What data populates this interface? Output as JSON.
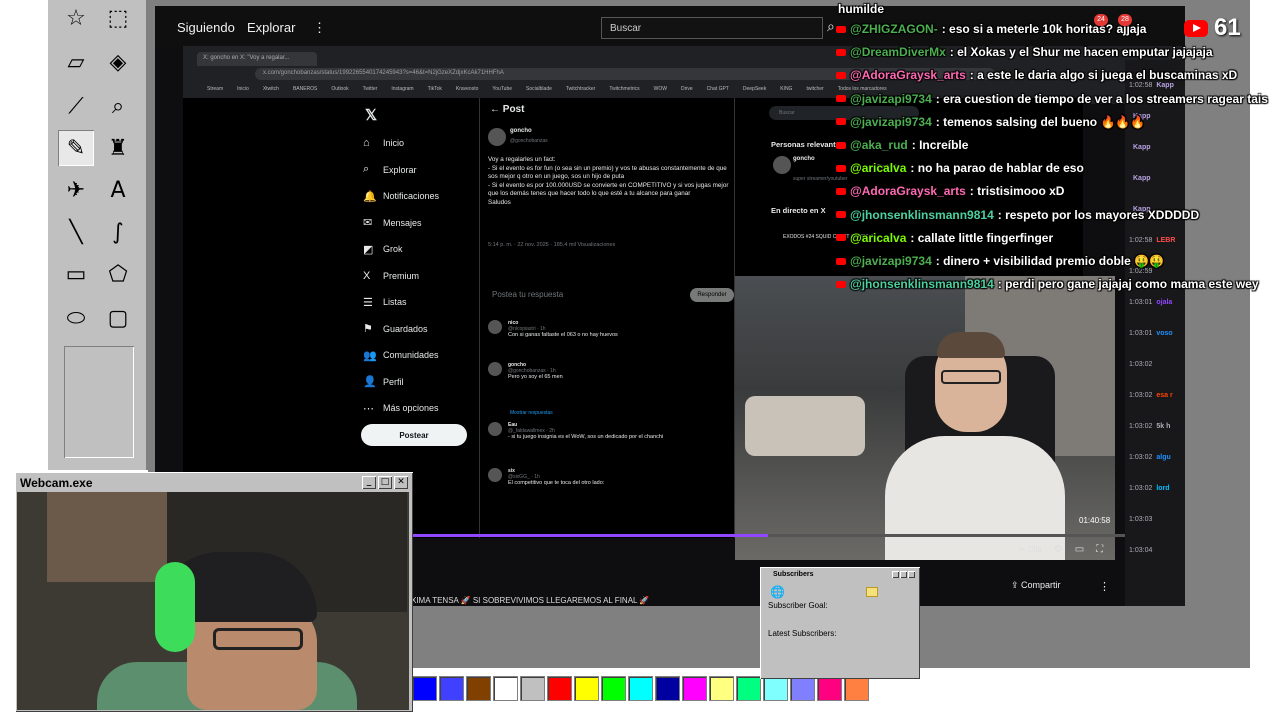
{
  "paint": {
    "tools": [
      "free-select",
      "rect-select",
      "eraser",
      "fill",
      "eyedropper",
      "zoom",
      "pencil",
      "brush",
      "airbrush",
      "text",
      "line",
      "curve",
      "rectangle",
      "polygon",
      "ellipse",
      "rounded-rect"
    ],
    "palette": [
      "#0000ff",
      "#4040ff",
      "#804000",
      "#ffffff",
      "#c0c0c0",
      "#ff0000",
      "#ffff00",
      "#00ff00",
      "#00ffff",
      "#0000a0",
      "#ff00ff",
      "#ffff80",
      "#00ff80",
      "#80ffff",
      "#8080ff",
      "#ff0080",
      "#ff8040"
    ]
  },
  "youtube": {
    "nav": [
      "Siguiendo",
      "Explorar"
    ],
    "more": "⋮",
    "search_placeholder": "Buscar",
    "share": "Compartir",
    "clip": "Clip",
    "time": "01:40:58",
    "progress": 0.48,
    "stream_title": "XIMA TENSA 🚀 SI SOBREVIVIMOS LLEGAREMOS AL FINAL 🚀"
  },
  "browser": {
    "tab": "X: goncho en X: \"Voy a regalar...",
    "url": "x.com/gonchobanzas/status/1992265540174245943?s=46&t=N2jGzeXZdjxKcAk71HHFhA",
    "bookmarks": [
      "Stream",
      "Inicio",
      "Xtwitch",
      "BANEROS",
      "Outlook",
      "Twitter",
      "Instagram",
      "TikTok",
      "Kraveosto",
      "YouTube",
      "Socialblade",
      "Twitchtracker",
      "Twitchmetrics",
      "WOW",
      "Drive",
      "Chat GPT",
      "DeepSeek",
      "KING",
      "twitcher",
      "Todos los marcadores"
    ]
  },
  "x": {
    "nav": [
      {
        "icon": "⌂",
        "label": "Inicio"
      },
      {
        "icon": "⌕",
        "label": "Explorar"
      },
      {
        "icon": "🔔",
        "label": "Notificaciones"
      },
      {
        "icon": "✉",
        "label": "Mensajes"
      },
      {
        "icon": "◩",
        "label": "Grok"
      },
      {
        "icon": "X",
        "label": "Premium"
      },
      {
        "icon": "☰",
        "label": "Listas"
      },
      {
        "icon": "⚑",
        "label": "Guardados"
      },
      {
        "icon": "👥",
        "label": "Comunidades"
      },
      {
        "icon": "👤",
        "label": "Perfil"
      },
      {
        "icon": "⋯",
        "label": "Más opciones"
      }
    ],
    "post_button": "Postear",
    "post_header": "Post",
    "author": "goncho",
    "handle": "@gonchobanzas",
    "text": "Voy a regalarles un fact:\n- Si el evento es for fun (o sea sin un premio) y vos te abusas constantemente de que sos mejor q otro en un juego, sos un hijo de puta\n- Si el evento es por 100.000USD se convierte en COMPETITIVO y si vos jugas mejor que los demás tenes que hacer todo lo que esté a tu alcance para ganar\nSaludos",
    "meta": "5:14 p. m. · 22 nov. 2025 · 185,4 mil Visualizaciones",
    "reply_placeholder": "Postea tu respuesta",
    "reply_button": "Responder",
    "comments": [
      {
        "name": "nico",
        "handle": "@nicopiastri · 1h",
        "text": "Con si ganas faltaste el 063 o no hay huevos"
      },
      {
        "name": "goncho",
        "handle": "@gonchobanzas · 1h",
        "text": "Pero yo soy el 65 men"
      },
      {
        "name": "Eau",
        "handle": "@_faldawallmex · 2h",
        "text": "- si tu juego insignia es el WoW, sos un dedicado por el chanchi"
      },
      {
        "name": "six",
        "handle": "@sixGG_ · 1h",
        "text": "El competitivo que te toca del otro lado:"
      }
    ],
    "show_replies": "Mostrar respuestas",
    "right_search": "Buscar",
    "relevant_title": "Personas relevantes",
    "relevant_name": "goncho",
    "relevant_sub": "super streamer/youtuber",
    "follow": "Siguiendo",
    "live_title": "En directo en X",
    "live_item": "EXODOS #24 SQUID CRAFT GAMES 4 -"
  },
  "chat": {
    "header_user": "humilde",
    "viewers": "61",
    "badge1": "24",
    "badge2": "28",
    "lines": [
      {
        "user": "@ZHIGZAGON-",
        "text": ": eso si a meterle 10k horitas? ajjaja",
        "color": "green"
      },
      {
        "user": "@DreamDiverMx",
        "text": ": el Xokas y el Shur me hacen emputar jajajaja",
        "color": "green"
      },
      {
        "user": "@AdoraGraysk_arts",
        "text": ": a este le daria algo si juega el buscaminas xD",
        "color": "pink"
      },
      {
        "user": "@javizapi9734",
        "text": ": era cuestion de tiempo de ver a los streamers ragear tais",
        "color": "green"
      },
      {
        "user": "@javizapi9734",
        "text": ": temenos salsing del bueno 🔥🔥🔥",
        "color": "green"
      },
      {
        "user": "@aka_rud",
        "text": ": Increíble",
        "color": "green"
      },
      {
        "user": "@aricalva",
        "text": ": no ha parao de hablar de eso",
        "color": "green2"
      },
      {
        "user": "@AdoraGraysk_arts",
        "text": ": tristisimooo xD",
        "color": "pink"
      },
      {
        "user": "@jhonsenklinsmann9814",
        "text": ": respeto por los mayores XDDDDD",
        "color": "teal"
      },
      {
        "user": "@aricalva",
        "text": ": callate little fingerfinger",
        "color": "green2"
      },
      {
        "user": "@javizapi9734",
        "text": ": dinero + visibilidad premio doble 🤑🤑",
        "color": "green"
      },
      {
        "user": "@jhonsenklinsmann9814",
        "text": ": perdi pero gane jajajaj como mama este wey",
        "color": "teal"
      }
    ],
    "side": [
      {
        "time": "1:02:58",
        "name": "Kapp"
      },
      {
        "time": "",
        "name": "Kapp"
      },
      {
        "time": "",
        "name": "Kapp"
      },
      {
        "time": "",
        "name": "Kapp"
      },
      {
        "time": "",
        "name": "Kapp"
      },
      {
        "time": "1:02:58",
        "name": "LEBR"
      },
      {
        "time": "1:02:59",
        "name": ""
      },
      {
        "time": "1:03:01",
        "name": "ojala"
      },
      {
        "time": "1:03:01",
        "name": "voso"
      },
      {
        "time": "1:03:02",
        "name": ""
      },
      {
        "time": "1:03:02",
        "name": "esa r"
      },
      {
        "time": "1:03:02",
        "name": "5k h"
      },
      {
        "time": "1:03:02",
        "name": "algu"
      },
      {
        "time": "1:03:02",
        "name": "lord"
      },
      {
        "time": "1:03:03",
        "name": ""
      },
      {
        "time": "1:03:04",
        "name": ""
      }
    ]
  },
  "webcam_window": {
    "title": "Webcam.exe",
    "btn_min": "_",
    "btn_max": "□",
    "btn_close": "✕"
  },
  "subs_window": {
    "title": "Subscribers",
    "goal": "Subscriber Goal:",
    "latest": "Latest Subscribers:"
  }
}
